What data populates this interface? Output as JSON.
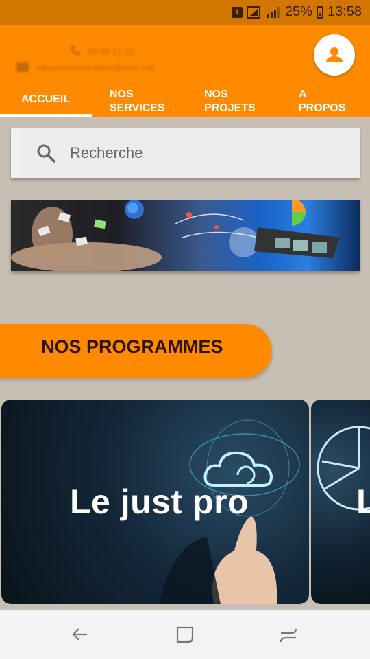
{
  "status_bar": {
    "sim": "1",
    "battery_percent": "25%",
    "time": "13:58"
  },
  "header": {
    "phone": "20 66 11 22",
    "email": "mbacommunication@corp.net",
    "tabs": [
      {
        "label": "ACCUEIL",
        "active": true
      },
      {
        "label": "NOS SERVICES",
        "active": false
      },
      {
        "label": "NOS PROJETS",
        "active": false
      },
      {
        "label": "A PROPOS",
        "active": false
      }
    ]
  },
  "search": {
    "placeholder": "Recherche"
  },
  "section": {
    "title": "NOS PROGRAMMES"
  },
  "programs": [
    {
      "title": "Le just pro"
    },
    {
      "title": "L"
    }
  ],
  "colors": {
    "accent": "#ff8a00",
    "status_bar": "#d27600",
    "background": "#c8bfb4"
  },
  "icons": {
    "account": "account-icon",
    "search": "search-icon",
    "back": "back-icon",
    "home": "home-icon",
    "recents": "recents-icon"
  }
}
